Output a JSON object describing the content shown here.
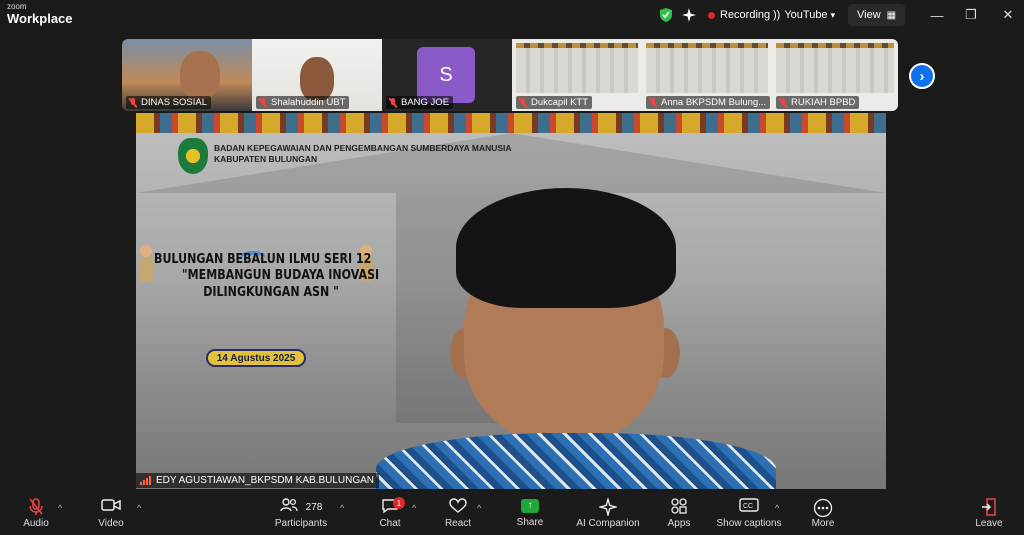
{
  "app": {
    "logo_line1": "zoom",
    "logo_line2": "Workplace"
  },
  "topbar": {
    "recording_label": "Recording",
    "youtube_label": "YouTube",
    "view_label": "View",
    "colors": {
      "recording_dot": "#e02828",
      "shield": "#2fbf4a"
    }
  },
  "gallery": {
    "tiles": [
      {
        "name": "DINAS SOSIAL",
        "muted": true
      },
      {
        "name": "Shalahuddin UBT",
        "muted": true
      },
      {
        "name": "BANG JOE",
        "muted": true,
        "avatar_letter": "S"
      },
      {
        "name": "Dukcapil KTT",
        "muted": true
      },
      {
        "name": "Anna BKPSDM Bulung...",
        "muted": true
      },
      {
        "name": "RUKIAH BPBD",
        "muted": true
      }
    ],
    "next_icon": "chevron-right-icon"
  },
  "slide": {
    "org_line1": "BADAN KEPEGAWAIAN DAN PENGEMBANGAN SUMBERDAYA MANUSIA",
    "org_line2": "KABUPATEN BULUNGAN",
    "title_line1": "BULUNGAN BEBALUN ILMU SERI 12",
    "title_line2": "\"MEMBANGUN BUDAYA INOVASI",
    "title_line3": "DILINGKUNGAN ASN \"",
    "date": "14 Agustus 2025"
  },
  "speaker": {
    "name": "EDY AGUSTIAWAN_BKPSDM KAB.BULUNGAN"
  },
  "toolbar": {
    "audio": "Audio",
    "video": "Video",
    "participants": "Participants",
    "participants_count": "278",
    "chat": "Chat",
    "chat_badge": "1",
    "react": "React",
    "share": "Share",
    "ai_companion": "AI Companion",
    "apps": "Apps",
    "captions": "Show captions",
    "more": "More",
    "leave": "Leave",
    "colors": {
      "share": "#1fa83a",
      "leave": "#e44444",
      "next_button": "#0e71eb"
    }
  }
}
